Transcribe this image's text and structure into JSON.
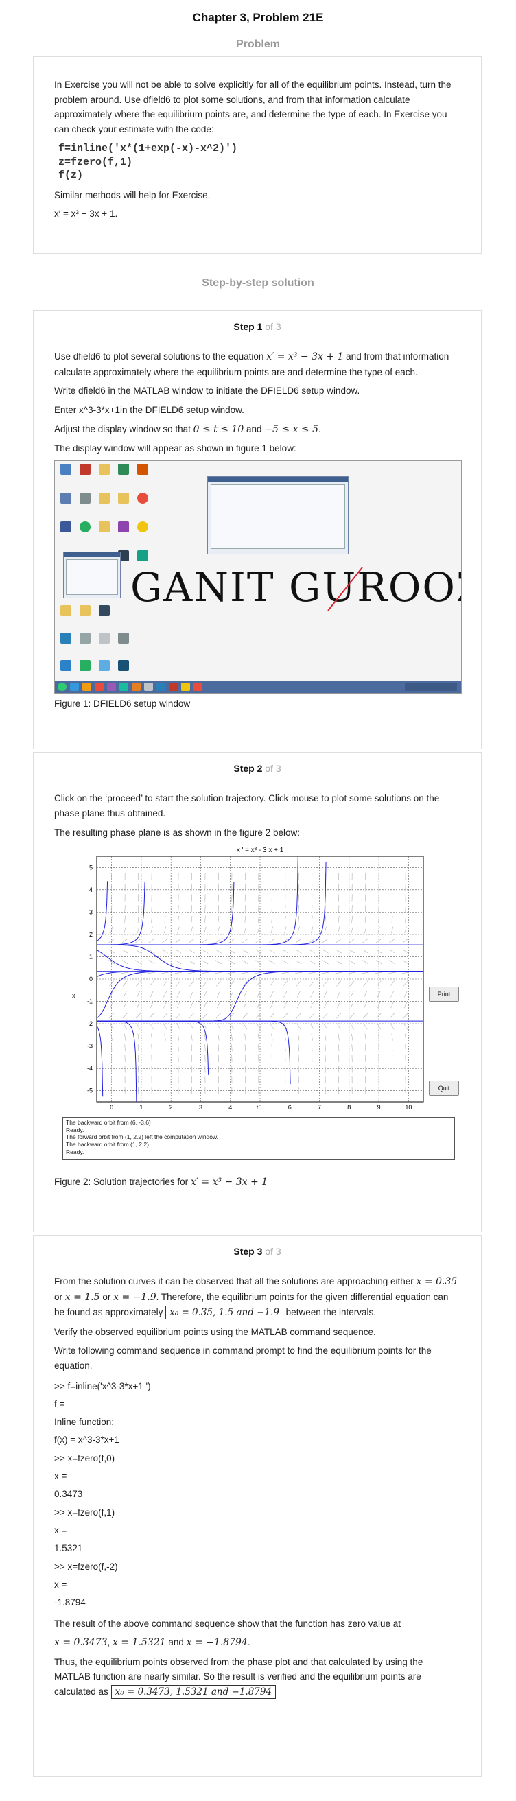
{
  "page_title": "Chapter 3, Problem 21E",
  "problem_heading": "Problem",
  "problem": {
    "intro": "In Exercise you will not be able to solve explicitly for all of the equilibrium points. Instead, turn the problem around. Use dfield6 to plot some solutions, and from that information calculate approximately where the equilibrium points are, and determine the type of each. In Exercise you can check your estimate with the code:",
    "code_lines": [
      "f=inline('x*(1+exp(-x)-x^2)')",
      "z=fzero(f,1)",
      "f(z)"
    ],
    "similar": "Similar methods will help for Exercise.",
    "equation": "x′ = x³ − 3x + 1."
  },
  "solution_heading": "Step-by-step solution",
  "step1": {
    "label": "Step 1",
    "of": "of 3",
    "p1_before": "Use dfield6 to plot several solutions to the equation",
    "p1_math": "x′ = x³ − 3x + 1",
    "p1_after": "and from that information calculate approximately where the equilibrium points are and determine the type of each.",
    "p2": "Write dfield6 in the MATLAB window to initiate the DFIELD6 setup window.",
    "p3": "Enter x^3-3*x+1in the DFIELD6 setup window.",
    "p4_before": "Adjust the display window so that",
    "p4_math1": "0 ≤ t ≤ 10",
    "p4_and": "and",
    "p4_math2": "−5 ≤ x ≤ 5",
    "p4_after": ".",
    "p5": "The display window will appear as shown in figure 1 below:",
    "watermark": "GANIT GUROOZ",
    "caption": "Figure 1: DFIELD6 setup window"
  },
  "step2": {
    "label": "Step 2",
    "of": "of 3",
    "p1": "Click on the ‘proceed’ to start the solution trajectory. Click mouse to plot some solutions on the phase plane thus obtained.",
    "p2": "The resulting phase plane is as shown in the figure 2 below:",
    "plot_title": "x ' = x³ - 3 x + 1",
    "print_label": "Print",
    "quit_label": "Quit",
    "messages": [
      "The backward orbit from (6, -3.6)",
      "Ready.",
      "The forward orbit from (1, 2.2) left the computation window.",
      "The backward orbit from (1, 2.2)",
      "Ready."
    ],
    "caption_before": "Figure 2: Solution trajectories for",
    "caption_math": "x′ = x³ − 3x + 1"
  },
  "chart_data": {
    "type": "line",
    "title": "x ' = x³ - 3 x + 1",
    "xlabel": "t",
    "ylabel": "x",
    "xlim": [
      -0.5,
      10.5
    ],
    "ylim": [
      -5.5,
      5.5
    ],
    "xticks": [
      0,
      1,
      2,
      3,
      4,
      5,
      6,
      7,
      8,
      9,
      10
    ],
    "yticks": [
      5,
      4,
      3,
      2,
      1,
      0,
      -1,
      -2,
      -3,
      -4,
      -5
    ],
    "grid": true,
    "equilibria": [
      1.5321,
      0.3473,
      -1.8794
    ],
    "trajectory_starts": [
      [
        -0.5,
        1.7
      ],
      [
        -0.5,
        1.3
      ],
      [
        -0.5,
        0.1
      ],
      [
        -0.5,
        -1.75
      ],
      [
        -0.5,
        -2.1
      ],
      [
        1,
        2.2
      ],
      [
        4,
        2.2
      ],
      [
        6,
        1.8
      ],
      [
        3,
        -2.0
      ],
      [
        6,
        -3.6
      ],
      [
        2,
        0.6
      ],
      [
        5,
        0.2
      ],
      [
        7,
        1.9
      ],
      [
        0.5,
        -1.95
      ]
    ],
    "line_color": "#1f1fe0"
  },
  "step3": {
    "label": "Step 3",
    "of": "of 3",
    "p1_a": "From the solution curves it can be observed that all the solutions are approaching either",
    "p1_m1": "x = 0.35",
    "p1_or1": "or",
    "p1_m2": "x = 1.5",
    "p1_or2": "or",
    "p1_m3": "x = −1.9",
    "p1_b": ". Therefore, the equilibrium points for the given differential equation can be found as approximately",
    "p1_box": "x₀ = 0.35, 1.5 and −1.9",
    "p1_c": "between the intervals.",
    "p2": "Verify the observed equilibrium points using the MATLAB command sequence.",
    "p3": "Write following command sequence in command prompt to find the equilibrium points for the equation.",
    "cmd_lines": [
      ">> f=inline('x^3-3*x+1 ')",
      "f =",
      "Inline function:",
      "f(x) = x^3-3*x+1",
      ">> x=fzero(f,0)",
      "x =",
      "0.3473",
      ">> x=fzero(f,1)",
      "x =",
      "1.5321",
      ">> x=fzero(f,-2)",
      "x =",
      "-1.8794"
    ],
    "p4": "The result of the above command sequence show that the function has zero value at",
    "p4_m1": "x = 0.3473",
    "p4_m2": "x = 1.5321",
    "p4_and": "and",
    "p4_m3": "x = −1.8794",
    "p5_a": "Thus, the equilibrium points observed from the phase plot and that calculated by using the MATLAB function are nearly similar. So the result is verified and the equilibrium points are calculated as",
    "p5_box": "x₀ = 0.3473, 1.5321 and −1.8794"
  }
}
